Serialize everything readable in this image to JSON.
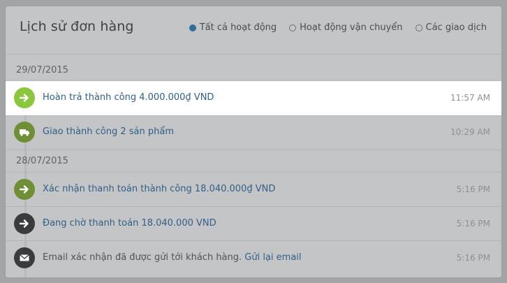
{
  "header": {
    "title": "Lịch sử đơn hàng",
    "filters": [
      {
        "label": "Tất cả hoạt động",
        "selected": true
      },
      {
        "label": "Hoạt động vận chuyển",
        "selected": false
      },
      {
        "label": "Các giao dịch",
        "selected": false
      }
    ]
  },
  "groups": [
    {
      "date": "29/07/2015",
      "items": [
        {
          "icon": "arrow-right-icon",
          "color": "#8cc63f",
          "text": "Hoàn trả thành công 4.000.000₫ VND",
          "time": "11:57 AM",
          "highlighted": true
        },
        {
          "icon": "truck-icon",
          "color": "#6f8f36",
          "text": "Giao thành công 2 sản phẩm",
          "time": "10:29 AM"
        }
      ]
    },
    {
      "date": "28/07/2015",
      "items": [
        {
          "icon": "arrow-right-icon",
          "color": "#6f8f36",
          "text": "Xác nhận thanh toán thành công 18.040.000₫ VND",
          "time": "5:16 PM"
        },
        {
          "icon": "arrow-right-icon",
          "color": "#3a3b3c",
          "text": "Đang chờ thanh toán 18.040.000 VND",
          "time": "5:16 PM"
        },
        {
          "icon": "envelope-icon",
          "color": "#3a3b3c",
          "text": "Email xác nhận đã được gửi tới khách hàng.",
          "link": "Gửi lại email",
          "time": "5:16 PM"
        }
      ]
    }
  ]
}
